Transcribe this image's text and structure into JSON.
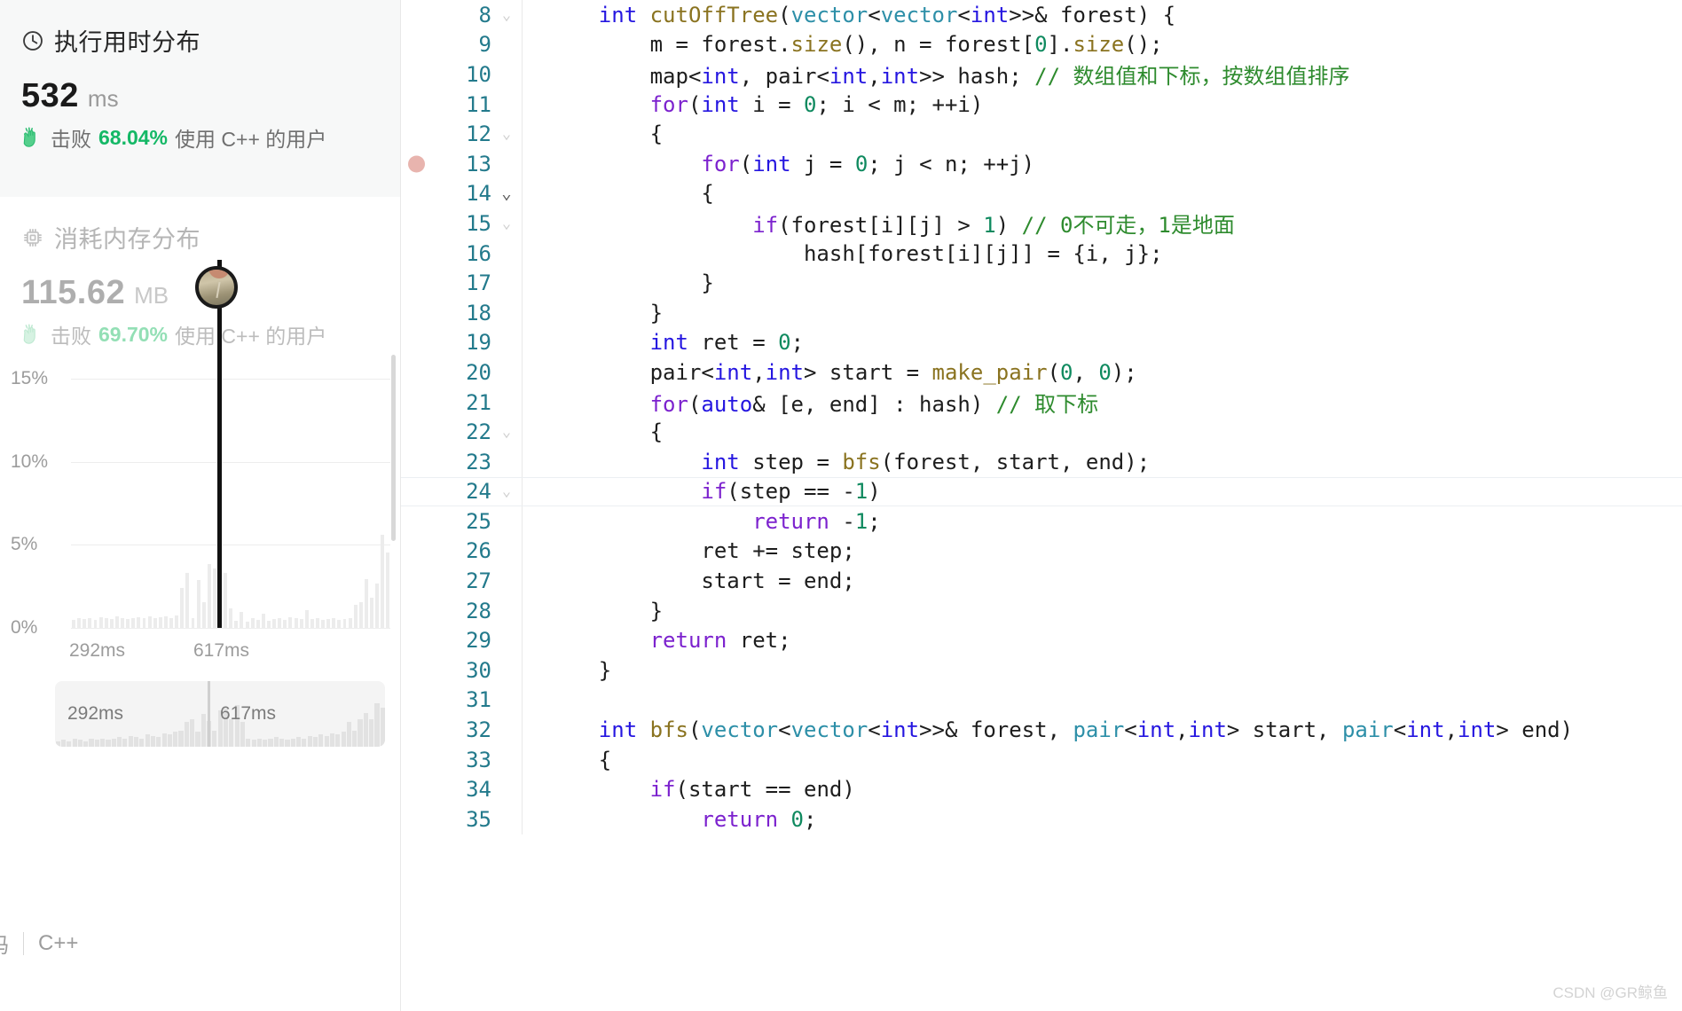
{
  "runtime": {
    "icon": "clock-icon",
    "title": "执行用时分布",
    "value": "532",
    "unit": "ms",
    "beat_prefix": "击败",
    "beat_pct": "68.04%",
    "beat_suffix": "使用 C++ 的用户",
    "accent_color": "#14b866"
  },
  "memory": {
    "icon": "chip-icon",
    "title": "消耗内存分布",
    "value": "115.62",
    "unit": "MB",
    "beat_prefix": "击败",
    "beat_pct": "69.70%",
    "beat_suffix": "使用 C++ 的用户",
    "accent_color": "#93dfb5"
  },
  "chart_data": {
    "type": "bar",
    "title": "执行用时分布",
    "xlabel": "",
    "ylabel": "",
    "grid": true,
    "ylim": [
      0,
      16
    ],
    "yticks": [
      "0%",
      "5%",
      "10%",
      "15%"
    ],
    "ytick_values": [
      0,
      5,
      10,
      15
    ],
    "xticks": [
      "292ms",
      "617ms"
    ],
    "xtick_values": [
      292,
      617
    ],
    "marker": {
      "label": "532 ms",
      "value": 10.2,
      "x_index": 27
    },
    "bar_color": "#ececec",
    "values": [
      0.5,
      0.6,
      0.55,
      0.6,
      0.5,
      0.65,
      0.6,
      0.55,
      0.7,
      0.6,
      0.55,
      0.6,
      0.65,
      0.6,
      0.7,
      0.6,
      0.65,
      0.7,
      0.6,
      0.75,
      2.4,
      3.3,
      0.6,
      2.9,
      1.55,
      3.85,
      3.55,
      0.2,
      3.3,
      1.2,
      0.45,
      0.95,
      0.35,
      0.6,
      0.5,
      0.85,
      0.45,
      0.55,
      0.6,
      0.5,
      0.65,
      0.6,
      0.55,
      1.05,
      0.55,
      0.6,
      0.5,
      0.55,
      0.6,
      0.5,
      0.55,
      0.6,
      1.4,
      1.55,
      2.95,
      1.8,
      2.65,
      5.6,
      4.55
    ]
  },
  "scrubber": {
    "left_label": "292ms",
    "right_label": "617ms",
    "values": [
      0.2,
      0.25,
      0.2,
      0.3,
      0.25,
      0.2,
      0.3,
      0.25,
      0.3,
      0.25,
      0.3,
      0.35,
      0.3,
      0.4,
      0.35,
      0.3,
      0.45,
      0.4,
      0.35,
      0.5,
      0.45,
      0.55,
      0.6,
      0.9,
      1.0,
      0.55,
      1.2,
      0.95,
      0.6,
      1.35,
      1.4,
      1.0,
      1.55,
      0.9,
      0.3,
      0.25,
      0.3,
      0.25,
      0.3,
      0.35,
      0.3,
      0.25,
      0.3,
      0.35,
      0.3,
      0.4,
      0.35,
      0.45,
      0.4,
      0.5,
      0.45,
      0.55,
      0.9,
      0.6,
      1.0,
      1.25,
      1.0,
      1.6,
      1.45
    ]
  },
  "footer": {
    "truncated_label": "码",
    "language": "C++"
  },
  "watermark": "CSDN @GR鲸鱼",
  "editor": {
    "start_line": 8,
    "breakpoint_line": 13,
    "highlight_line": 24,
    "folded_lines": [
      14,
      22,
      24
    ],
    "lines": [
      {
        "n": 8,
        "fold": "dim",
        "tokens": [
          [
            "p",
            "    "
          ],
          [
            "t",
            "int"
          ],
          [
            "p",
            " "
          ],
          [
            "fn",
            "cutOffTree"
          ],
          [
            "p",
            "("
          ],
          [
            "ty",
            "vector"
          ],
          [
            "p",
            "<"
          ],
          [
            "ty",
            "vector"
          ],
          [
            "p",
            "<"
          ],
          [
            "t",
            "int"
          ],
          [
            "p",
            ">>& forest) {"
          ]
        ]
      },
      {
        "n": 9,
        "fold": "",
        "tokens": [
          [
            "p",
            "        m = forest."
          ],
          [
            "fn",
            "size"
          ],
          [
            "p",
            "(), n = forest["
          ],
          [
            "n",
            "0"
          ],
          [
            "p",
            "]."
          ],
          [
            "fn",
            "size"
          ],
          [
            "p",
            "();"
          ]
        ]
      },
      {
        "n": 10,
        "fold": "",
        "tokens": [
          [
            "p",
            "        map<"
          ],
          [
            "t",
            "int"
          ],
          [
            "p",
            ", pair<"
          ],
          [
            "t",
            "int"
          ],
          [
            "p",
            ","
          ],
          [
            "t",
            "int"
          ],
          [
            "p",
            ">> hash; "
          ],
          [
            "c",
            "// 数组值和下标，按数组值排序"
          ]
        ]
      },
      {
        "n": 11,
        "fold": "",
        "tokens": [
          [
            "p",
            "        "
          ],
          [
            "k",
            "for"
          ],
          [
            "p",
            "("
          ],
          [
            "t",
            "int"
          ],
          [
            "p",
            " i = "
          ],
          [
            "n",
            "0"
          ],
          [
            "p",
            "; i < m; ++i)"
          ]
        ]
      },
      {
        "n": 12,
        "fold": "dim",
        "tokens": [
          [
            "p",
            "        {"
          ]
        ]
      },
      {
        "n": 13,
        "fold": "",
        "tokens": [
          [
            "p",
            "            "
          ],
          [
            "k",
            "for"
          ],
          [
            "p",
            "("
          ],
          [
            "t",
            "int"
          ],
          [
            "p",
            " j = "
          ],
          [
            "n",
            "0"
          ],
          [
            "p",
            "; j < n; ++j)"
          ]
        ]
      },
      {
        "n": 14,
        "fold": "on",
        "tokens": [
          [
            "p",
            "            {"
          ]
        ]
      },
      {
        "n": 15,
        "fold": "dim",
        "tokens": [
          [
            "p",
            "                "
          ],
          [
            "k",
            "if"
          ],
          [
            "p",
            "(forest[i][j] > "
          ],
          [
            "n",
            "1"
          ],
          [
            "p",
            ") "
          ],
          [
            "c",
            "// 0不可走，1是地面"
          ]
        ]
      },
      {
        "n": 16,
        "fold": "",
        "tokens": [
          [
            "p",
            "                    hash[forest[i][j]] = {i, j};"
          ]
        ]
      },
      {
        "n": 17,
        "fold": "",
        "tokens": [
          [
            "p",
            "            }"
          ]
        ]
      },
      {
        "n": 18,
        "fold": "",
        "tokens": [
          [
            "p",
            "        }"
          ]
        ]
      },
      {
        "n": 19,
        "fold": "",
        "tokens": [
          [
            "p",
            "        "
          ],
          [
            "t",
            "int"
          ],
          [
            "p",
            " ret = "
          ],
          [
            "n",
            "0"
          ],
          [
            "p",
            ";"
          ]
        ]
      },
      {
        "n": 20,
        "fold": "",
        "tokens": [
          [
            "p",
            "        pair<"
          ],
          [
            "t",
            "int"
          ],
          [
            "p",
            ","
          ],
          [
            "t",
            "int"
          ],
          [
            "p",
            "> start = "
          ],
          [
            "fn",
            "make_pair"
          ],
          [
            "p",
            "("
          ],
          [
            "n",
            "0"
          ],
          [
            "p",
            ", "
          ],
          [
            "n",
            "0"
          ],
          [
            "p",
            ");"
          ]
        ]
      },
      {
        "n": 21,
        "fold": "",
        "tokens": [
          [
            "p",
            "        "
          ],
          [
            "k",
            "for"
          ],
          [
            "p",
            "("
          ],
          [
            "t",
            "auto"
          ],
          [
            "p",
            "& [e, end] : hash) "
          ],
          [
            "c",
            "// 取下标"
          ]
        ]
      },
      {
        "n": 22,
        "fold": "dim",
        "tokens": [
          [
            "p",
            "        {"
          ]
        ]
      },
      {
        "n": 23,
        "fold": "",
        "tokens": [
          [
            "p",
            "            "
          ],
          [
            "t",
            "int"
          ],
          [
            "p",
            " step = "
          ],
          [
            "fn",
            "bfs"
          ],
          [
            "p",
            "(forest, start, end);"
          ]
        ]
      },
      {
        "n": 24,
        "fold": "dim",
        "tokens": [
          [
            "p",
            "            "
          ],
          [
            "k",
            "if"
          ],
          [
            "p",
            "(step == -"
          ],
          [
            "n",
            "1"
          ],
          [
            "p",
            ")"
          ]
        ]
      },
      {
        "n": 25,
        "fold": "",
        "tokens": [
          [
            "p",
            "                "
          ],
          [
            "k",
            "return"
          ],
          [
            "p",
            " -"
          ],
          [
            "n",
            "1"
          ],
          [
            "p",
            ";"
          ]
        ]
      },
      {
        "n": 26,
        "fold": "",
        "tokens": [
          [
            "p",
            "            ret += step;"
          ]
        ]
      },
      {
        "n": 27,
        "fold": "",
        "tokens": [
          [
            "p",
            "            start = end;"
          ]
        ]
      },
      {
        "n": 28,
        "fold": "",
        "tokens": [
          [
            "p",
            "        }"
          ]
        ]
      },
      {
        "n": 29,
        "fold": "",
        "tokens": [
          [
            "p",
            "        "
          ],
          [
            "k",
            "return"
          ],
          [
            "p",
            " ret;"
          ]
        ]
      },
      {
        "n": 30,
        "fold": "",
        "tokens": [
          [
            "p",
            "    }"
          ]
        ]
      },
      {
        "n": 31,
        "fold": "",
        "tokens": [
          [
            "p",
            ""
          ]
        ]
      },
      {
        "n": 32,
        "fold": "",
        "tokens": [
          [
            "p",
            "    "
          ],
          [
            "t",
            "int"
          ],
          [
            "p",
            " "
          ],
          [
            "fn",
            "bfs"
          ],
          [
            "p",
            "("
          ],
          [
            "ty",
            "vector"
          ],
          [
            "p",
            "<"
          ],
          [
            "ty",
            "vector"
          ],
          [
            "p",
            "<"
          ],
          [
            "t",
            "int"
          ],
          [
            "p",
            ">>& forest, "
          ],
          [
            "ty",
            "pair"
          ],
          [
            "p",
            "<"
          ],
          [
            "t",
            "int"
          ],
          [
            "p",
            ","
          ],
          [
            "t",
            "int"
          ],
          [
            "p",
            "> start, "
          ],
          [
            "ty",
            "pair"
          ],
          [
            "p",
            "<"
          ],
          [
            "t",
            "int"
          ],
          [
            "p",
            ","
          ],
          [
            "t",
            "int"
          ],
          [
            "p",
            "> end)"
          ]
        ]
      },
      {
        "n": 33,
        "fold": "",
        "tokens": [
          [
            "p",
            "    {"
          ]
        ]
      },
      {
        "n": 34,
        "fold": "",
        "tokens": [
          [
            "p",
            "        "
          ],
          [
            "k",
            "if"
          ],
          [
            "p",
            "(start == end)"
          ]
        ]
      },
      {
        "n": 35,
        "fold": "",
        "tokens": [
          [
            "p",
            "            "
          ],
          [
            "k",
            "return"
          ],
          [
            "p",
            " "
          ],
          [
            "n",
            "0"
          ],
          [
            "p",
            ";"
          ]
        ]
      }
    ]
  }
}
